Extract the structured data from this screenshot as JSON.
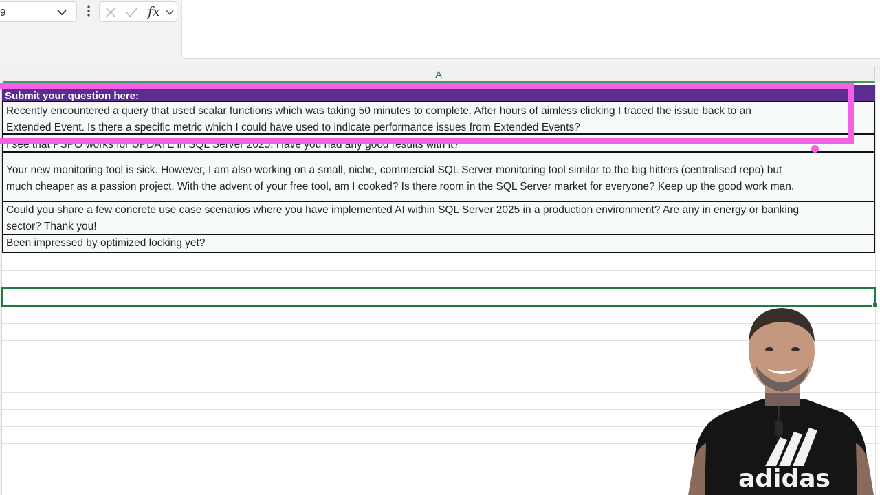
{
  "formula_bar": {
    "name_box_value": "9",
    "function_label": "fx",
    "formula_value": ""
  },
  "column_headers": [
    "A"
  ],
  "sheet": {
    "header_cell": "Submit your question here:",
    "questions": [
      {
        "lines": [
          "Recently encountered a query that used scalar functions which was taking 50 minutes to complete. After hours of aimless clicking I traced the issue back to an",
          "Extended Event. Is there a specific metric which I could have used to indicate performance issues from Extended Events?"
        ]
      },
      {
        "lines": [
          "I see that PSPO works for UPDATE in SQL Server 2025. Have you had any good results with it?"
        ]
      },
      {
        "lines": [
          "Your new monitoring tool is sick.  However, I am also working on a small, niche, commercial SQL Server monitoring tool similar to the big hitters (centralised repo) but",
          "much cheaper as a passion project.  With the advent of your free tool, am I cooked? Is there room in the SQL Server market for everyone?  Keep up the good work man."
        ]
      },
      {
        "lines": [
          "Could you share a few concrete use case scenarios where you have implemented AI within SQL Server 2025 in a production environment? Are any in energy or banking",
          "sector? Thank you!"
        ]
      },
      {
        "lines": [
          "Been impressed by optimized locking yet?"
        ]
      }
    ]
  },
  "webcam": {
    "shirt_logo_text": "adidas"
  },
  "colors": {
    "header_fill": "#5c2d91",
    "highlight": "#f361e6",
    "selection": "#1f7a43",
    "cell_fill": "#f6fafa"
  }
}
